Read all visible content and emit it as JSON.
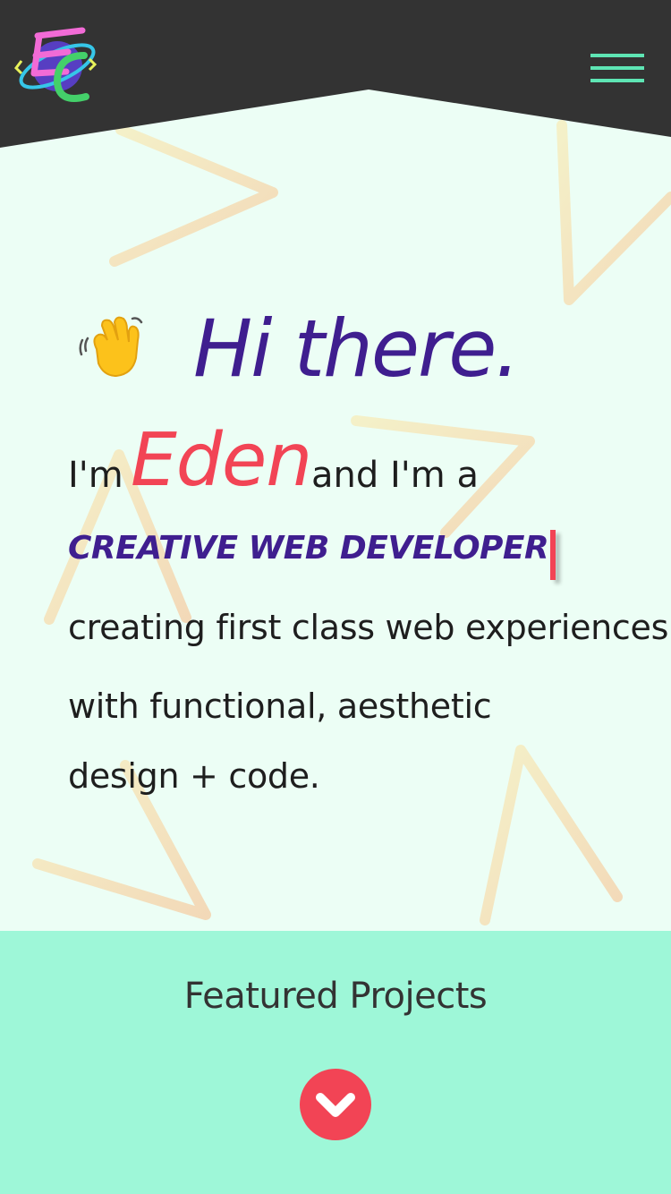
{
  "header": {
    "logo_alt": "EC",
    "menu_icon": "hamburger-menu-icon",
    "menu_color": "#5ee5b4",
    "background_color": "#333333"
  },
  "hero": {
    "wave_icon": "waving-hand-icon",
    "greeting": "Hi there.",
    "intro_prefix": "I'm",
    "name": "Eden",
    "intro_suffix": "and I'm a",
    "role": "CREATIVE WEB DEVELOPER",
    "description_line1": "creating first class web experiences",
    "description_line2": "with functional, aesthetic",
    "description_line3": "design + code."
  },
  "featured": {
    "title": "Featured Projects",
    "scroll_icon": "chevron-down-icon"
  },
  "colors": {
    "accent_purple": "#3f1e8f",
    "accent_red": "#f24455",
    "accent_mint": "#9ef7d8",
    "hero_background": "#ecfef5"
  }
}
